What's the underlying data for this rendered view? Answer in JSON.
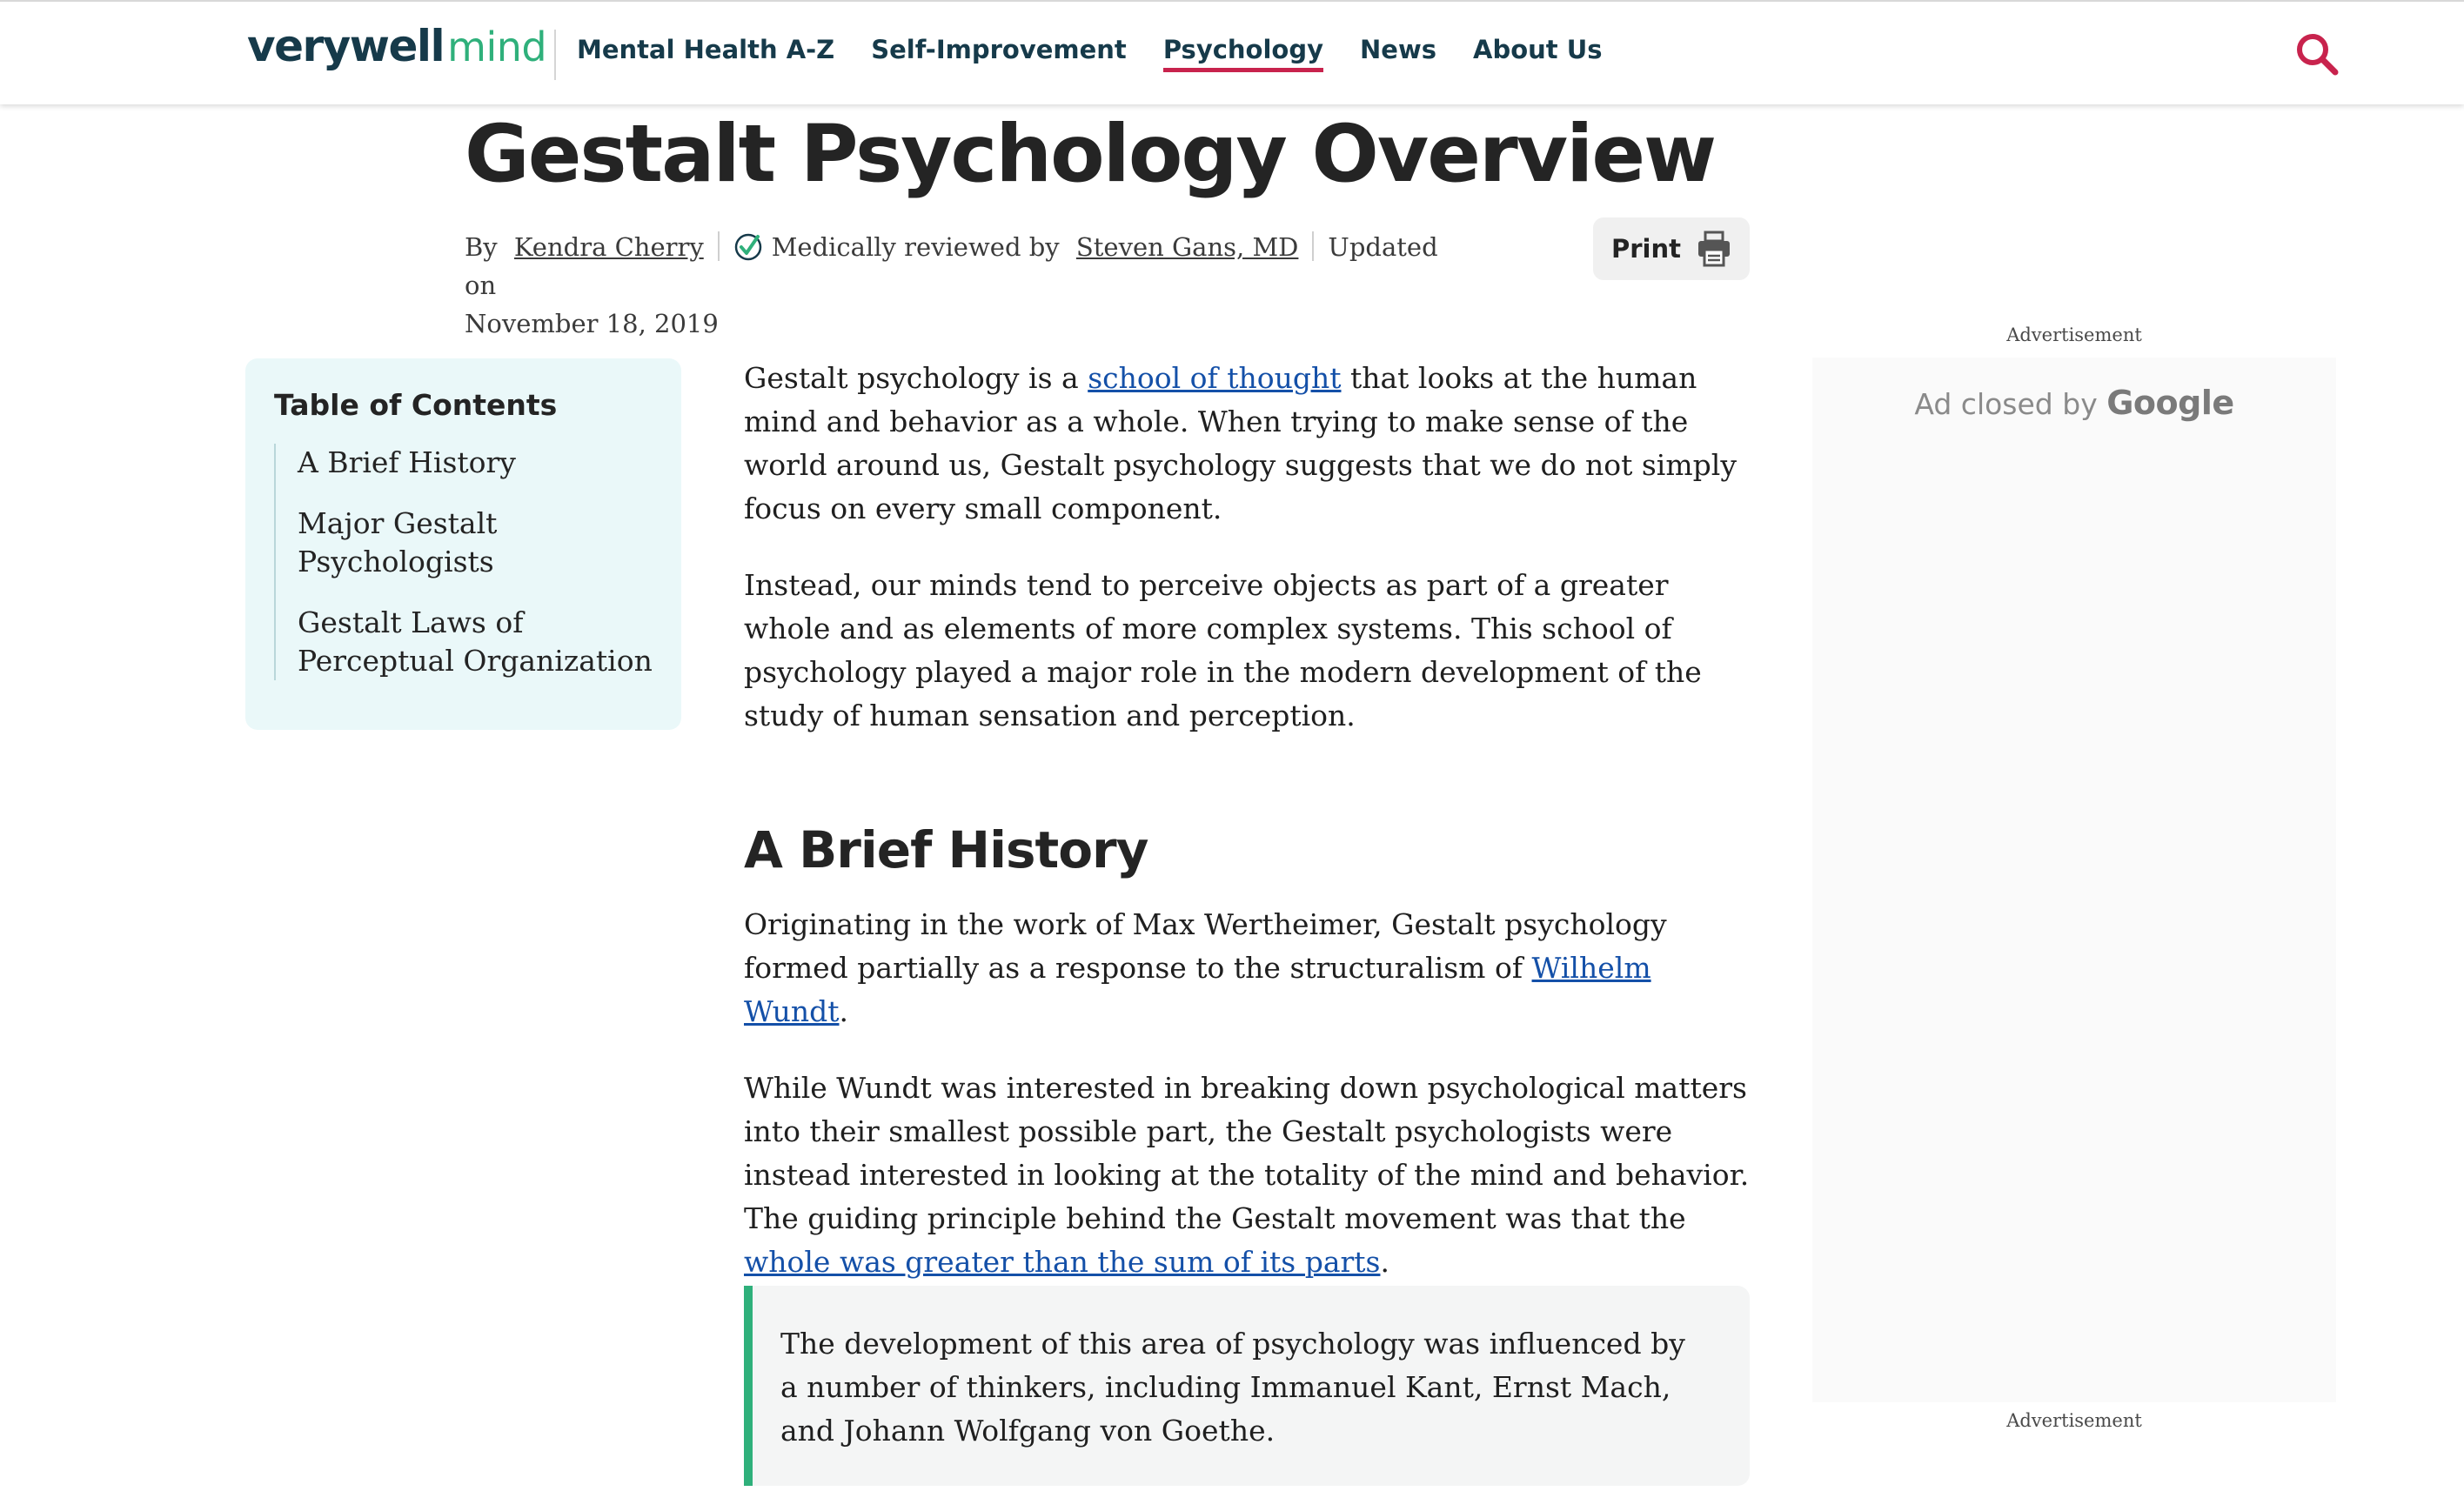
{
  "header": {
    "logo_primary": "verywell",
    "logo_secondary": "mind",
    "nav": [
      {
        "label": "Mental Health A-Z",
        "active": false
      },
      {
        "label": "Self-Improvement",
        "active": false
      },
      {
        "label": "Psychology",
        "active": true
      },
      {
        "label": "News",
        "active": false
      },
      {
        "label": "About Us",
        "active": false
      }
    ],
    "search_icon": "search-icon"
  },
  "article": {
    "title": "Gestalt Psychology Overview",
    "byline": {
      "by": "By",
      "author": "Kendra Cherry",
      "reviewed_prefix": "Medically reviewed by",
      "reviewer": "Steven Gans, MD",
      "updated_prefix": "Updated on",
      "updated_date": "November 18, 2019"
    },
    "print_label": "Print",
    "intro_p1": {
      "before": "Gestalt psychology is a ",
      "link": "school of thought",
      "after": " that looks at the human mind and behavior as a whole. When trying to make sense of the world around us, Gestalt psychology suggests that we do not simply focus on every small component."
    },
    "intro_p2": "Instead, our minds tend to perceive objects as part of a greater whole and as elements of more complex systems. This school of psychology played a major role in the modern development of the study of human sensation and perception.",
    "section_heading": "A Brief History",
    "history_p1": {
      "before": "Originating in the work of Max Wertheimer, Gestalt psychology formed partially as a response to the structuralism of ",
      "link": "Wilhelm Wundt",
      "after": "."
    },
    "history_p2": {
      "before": "While Wundt was interested in breaking down psychological matters into their smallest possible part, the Gestalt psychologists were instead interested in looking at the totality of the mind and behavior. The guiding principle behind the Gestalt movement was that the ",
      "link": "whole was greater than the sum of its parts",
      "after": "."
    },
    "callout": "The development of this area of psychology was influenced by a number of thinkers, including Immanuel Kant, Ernst Mach, and Johann Wolfgang von Goethe."
  },
  "toc": {
    "title": "Table of Contents",
    "items": [
      "A Brief History",
      "Major Gestalt Psychologists",
      "Gestalt Laws of Perceptual Organization"
    ]
  },
  "ad": {
    "label_top": "Advertisement",
    "closed_text": "Ad closed by",
    "closed_brand": "Google",
    "label_bottom": "Advertisement"
  },
  "colors": {
    "brand_dark": "#163a4a",
    "brand_green": "#2fb07b",
    "accent_red": "#c8234d",
    "link_blue": "#1450a8",
    "toc_bg": "#eaf8f9"
  }
}
